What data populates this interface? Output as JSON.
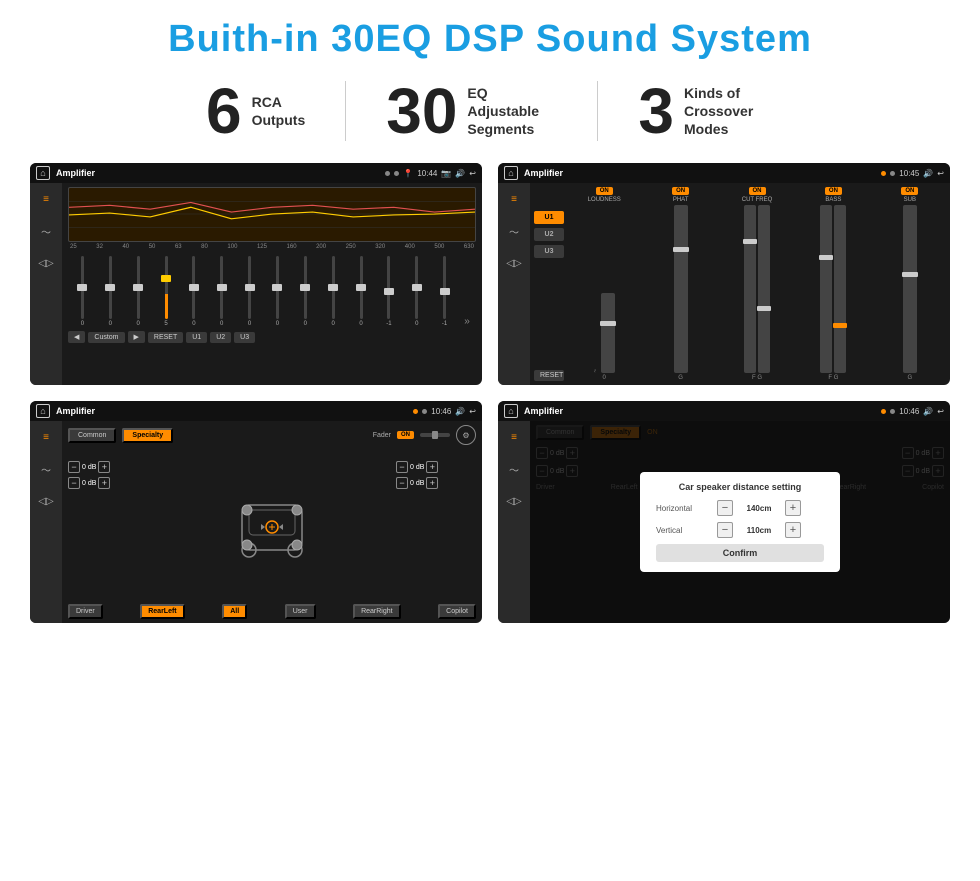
{
  "title": "Buith-in 30EQ DSP Sound System",
  "stats": [
    {
      "number": "6",
      "text": "RCA\nOutputs"
    },
    {
      "number": "30",
      "text": "EQ Adjustable\nSegments"
    },
    {
      "number": "3",
      "text": "Kinds of\nCrossover Modes"
    }
  ],
  "screens": {
    "eq": {
      "title": "Amplifier",
      "time": "10:44",
      "freqs": [
        "25",
        "32",
        "40",
        "50",
        "63",
        "80",
        "100",
        "125",
        "160",
        "200",
        "250",
        "320",
        "400",
        "500",
        "630"
      ],
      "values": [
        "0",
        "0",
        "0",
        "5",
        "0",
        "0",
        "0",
        "0",
        "0",
        "0",
        "0",
        "-1",
        "0",
        "-1"
      ],
      "preset": "Custom",
      "buttons": [
        "RESET",
        "U1",
        "U2",
        "U3"
      ]
    },
    "amp": {
      "title": "Amplifier",
      "time": "10:45",
      "channels": [
        "LOUDNESS",
        "PHAT",
        "CUT FREQ",
        "BASS",
        "SUB"
      ],
      "uButtons": [
        "U1",
        "U2",
        "U3"
      ]
    },
    "cross": {
      "title": "Amplifier",
      "time": "10:46",
      "tabs": [
        "Common",
        "Specialty"
      ],
      "faderLabel": "Fader",
      "faderOn": "ON",
      "controls": [
        "0 dB",
        "0 dB",
        "0 dB",
        "0 dB"
      ],
      "bottomBtns": [
        "Driver",
        "RearLeft",
        "All",
        "User",
        "RearRight",
        "Copilot"
      ]
    },
    "dist": {
      "title": "Amplifier",
      "time": "10:46",
      "modal": {
        "title": "Car speaker distance setting",
        "horizontal": {
          "label": "Horizontal",
          "value": "140cm"
        },
        "vertical": {
          "label": "Vertical",
          "value": "110cm"
        },
        "confirm": "Confirm"
      },
      "tabs": [
        "Common",
        "Specialty"
      ]
    }
  }
}
